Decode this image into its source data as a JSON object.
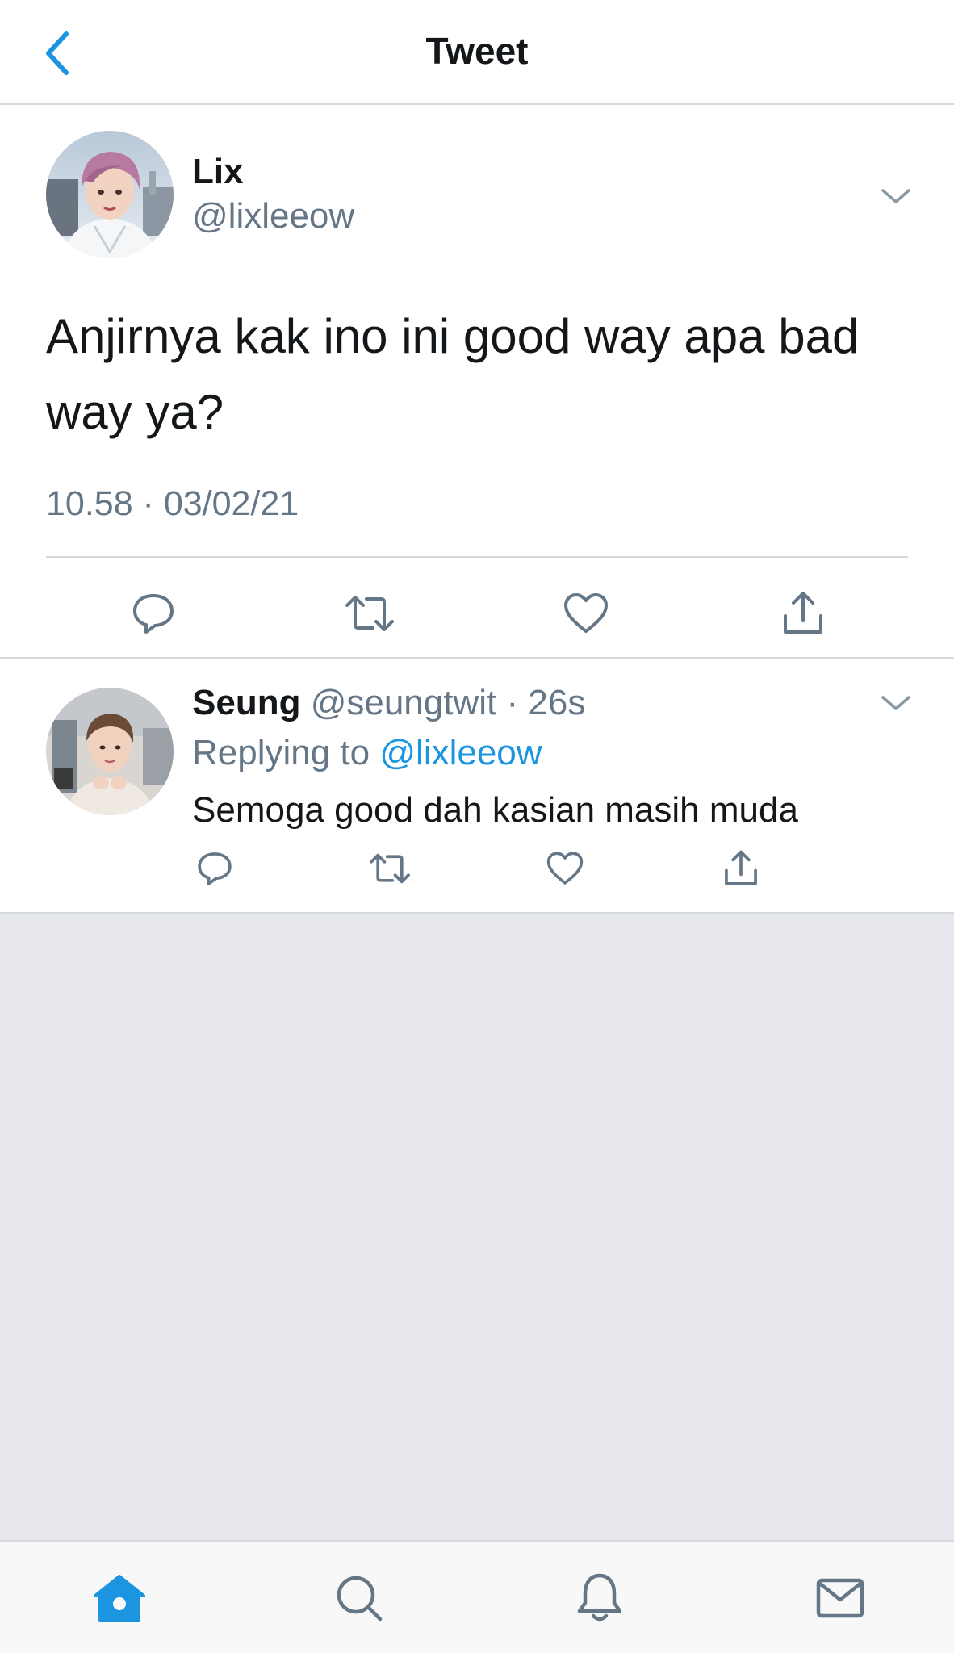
{
  "header": {
    "title": "Tweet",
    "back_icon": "chevron-left-icon"
  },
  "main_tweet": {
    "display_name": "Lix",
    "handle": "@lixleeow",
    "text": "Anjirnya kak ino ini good way apa bad way ya?",
    "timestamp": "10.58 · 03/02/21",
    "actions": [
      "reply-icon",
      "retweet-icon",
      "like-icon",
      "share-icon"
    ]
  },
  "reply": {
    "display_name": "Seung",
    "handle": "@seungtwit",
    "separator": "·",
    "age": "26s",
    "replying_prefix": "Replying to",
    "replying_to": "@lixleeow",
    "text": "Semoga good dah kasian masih muda",
    "actions": [
      "reply-icon",
      "retweet-icon",
      "like-icon",
      "share-icon"
    ]
  },
  "tabbar": {
    "tabs": [
      "home-icon",
      "search-icon",
      "notifications-icon",
      "messages-icon"
    ],
    "active": "home-icon"
  },
  "colors": {
    "accent": "#1b95e0",
    "secondary_text": "#657786",
    "icon": "#657786",
    "divider": "#d6d9dc",
    "empty_background": "#e6e8ed"
  }
}
